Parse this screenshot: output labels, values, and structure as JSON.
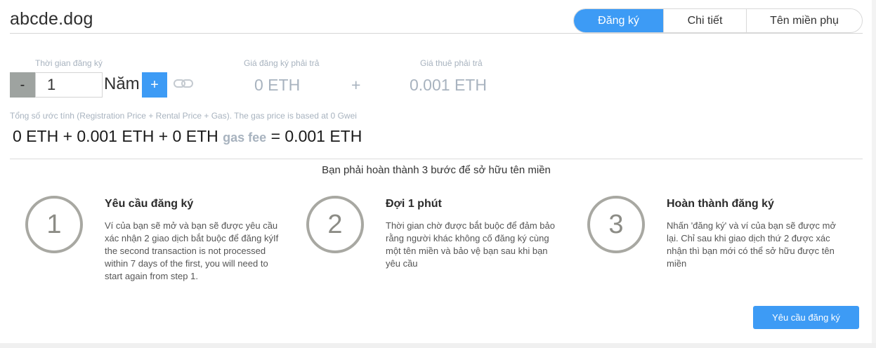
{
  "header": {
    "domain": "abcde.dog",
    "tabs": [
      "Đăng ký",
      "Chi tiết",
      "Tên miền phụ"
    ]
  },
  "registration": {
    "duration_label": "Thời gian đăng ký",
    "duration_value": "1",
    "unit": "Năm",
    "minus": "-",
    "plus": "+",
    "reg_price_label": "Giá đăng ký phải trả",
    "reg_price": "0 ETH",
    "plus_sign": "+",
    "rent_price_label": "Giá thuê phải trả",
    "rent_price": "0.001 ETH",
    "total_note": "Tổng số ước tính (Registration Price + Rental Price + Gas). The gas price is based at 0 Gwei",
    "total_expr": "0 ETH + 0.001 ETH + 0 ETH",
    "gas_fee_label": "gas fee",
    "total_result": "= 0.001 ETH"
  },
  "steps": {
    "heading": "Bạn phải hoàn thành 3 bước để sở hữu tên miền",
    "items": [
      {
        "number": "1",
        "title": "Yêu cầu đăng ký",
        "desc": "Ví của bạn sẽ mở và bạn sẽ được yêu cầu xác nhận 2 giao dịch bắt buộc để đăng kýIf the second transaction is not processed within 7 days of the first, you will need to start again from step 1."
      },
      {
        "number": "2",
        "title": "Đợi 1 phút",
        "desc": "Thời gian chờ được bắt buộc để đảm bảo rằng người khác không cố đăng ký cùng một tên miền và bảo vệ bạn sau khi bạn yêu cầu"
      },
      {
        "number": "3",
        "title": "Hoàn thành đăng ký",
        "desc": "Nhấn 'đăng ký' và ví của bạn sẽ được mở lại. Chỉ sau khi giao dịch thứ 2 được xác nhận thì bạn mới có thể sở hữu được tên miền"
      }
    ]
  },
  "actions": {
    "request_button": "Yêu cầu đăng ký"
  },
  "colors": {
    "accent": "#3d9bf5",
    "muted_text": "#a8b3bf",
    "circle": "#a8a8a2"
  },
  "icons": {
    "link": "link-icon"
  }
}
